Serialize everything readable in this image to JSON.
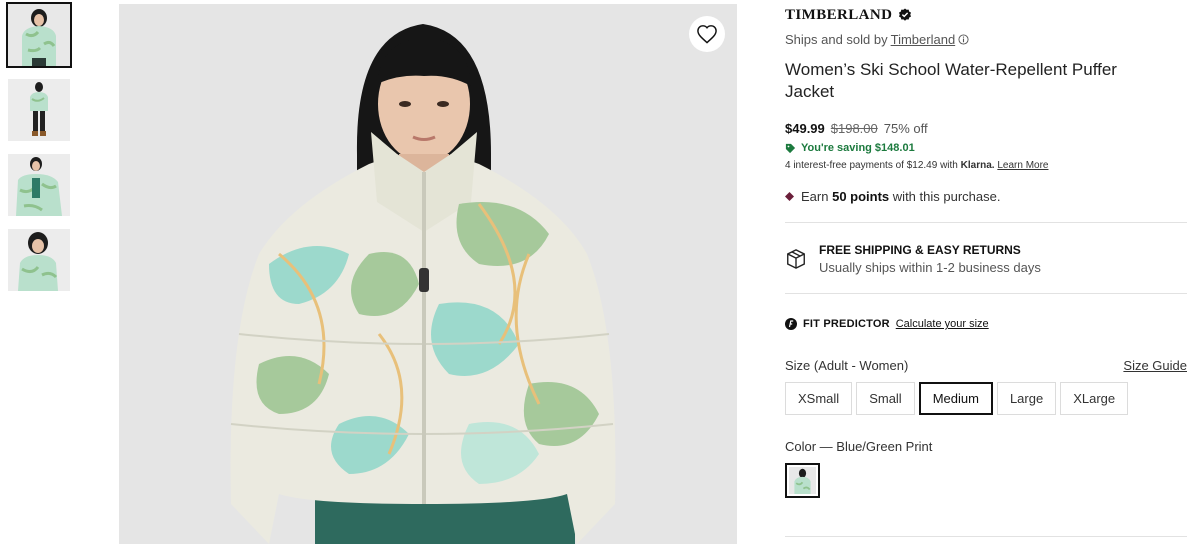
{
  "brand": {
    "name": "TIMBERLAND",
    "verified_icon": "verified-badge-icon"
  },
  "seller": {
    "prefix": "Ships and sold by",
    "link": "Timberland",
    "info_icon": "info-icon"
  },
  "product": {
    "title": "Women’s Ski School Water-Repellent Puffer Jacket"
  },
  "price": {
    "current": "$49.99",
    "was": "$198.00",
    "discount": "75% off",
    "saving": "You're saving $148.01",
    "klarna_text": "4 interest-free payments of $12.49 with",
    "klarna_brand": "Klarna.",
    "klarna_link": "Learn More"
  },
  "points": {
    "prefix": "Earn",
    "amount": "50 points",
    "suffix": "with this purchase."
  },
  "shipping": {
    "title": "FREE SHIPPING & EASY RETURNS",
    "subtitle": "Usually ships within 1-2 business days"
  },
  "fit": {
    "label": "FIT PREDICTOR",
    "link": "Calculate your size"
  },
  "size": {
    "label": "Size (Adult - Women)",
    "guide": "Size Guide",
    "options": [
      "XSmall",
      "Small",
      "Medium",
      "Large",
      "XLarge"
    ],
    "selected": "Medium"
  },
  "color": {
    "label": "Color — Blue/Green Print"
  },
  "colors": {
    "accent": "#111111",
    "saving_green": "#1c7a3e",
    "points_diamond": "#6b1f3a",
    "jacket_mint": "#a8d9c3",
    "jacket_green": "#9cc79a",
    "jacket_cream": "#eae8dc"
  }
}
